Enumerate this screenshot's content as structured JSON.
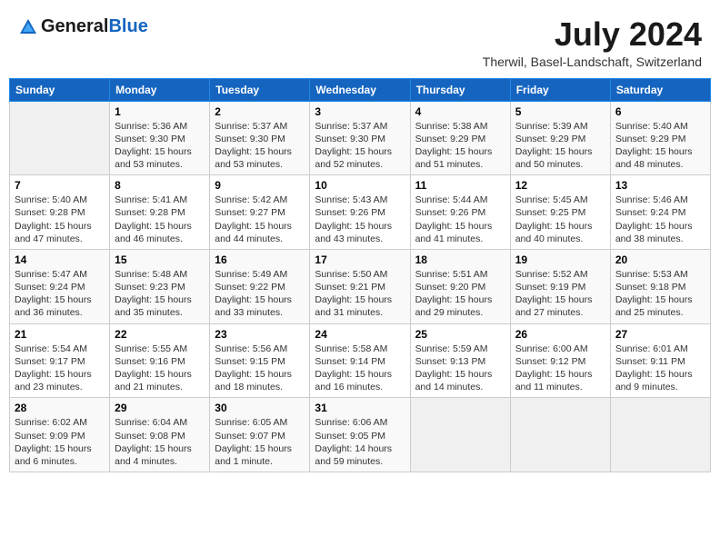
{
  "logo": {
    "general": "General",
    "blue": "Blue"
  },
  "title": "July 2024",
  "location": "Therwil, Basel-Landschaft, Switzerland",
  "days_of_week": [
    "Sunday",
    "Monday",
    "Tuesday",
    "Wednesday",
    "Thursday",
    "Friday",
    "Saturday"
  ],
  "weeks": [
    [
      {
        "day": "",
        "info": ""
      },
      {
        "day": "1",
        "info": "Sunrise: 5:36 AM\nSunset: 9:30 PM\nDaylight: 15 hours\nand 53 minutes."
      },
      {
        "day": "2",
        "info": "Sunrise: 5:37 AM\nSunset: 9:30 PM\nDaylight: 15 hours\nand 53 minutes."
      },
      {
        "day": "3",
        "info": "Sunrise: 5:37 AM\nSunset: 9:30 PM\nDaylight: 15 hours\nand 52 minutes."
      },
      {
        "day": "4",
        "info": "Sunrise: 5:38 AM\nSunset: 9:29 PM\nDaylight: 15 hours\nand 51 minutes."
      },
      {
        "day": "5",
        "info": "Sunrise: 5:39 AM\nSunset: 9:29 PM\nDaylight: 15 hours\nand 50 minutes."
      },
      {
        "day": "6",
        "info": "Sunrise: 5:40 AM\nSunset: 9:29 PM\nDaylight: 15 hours\nand 48 minutes."
      }
    ],
    [
      {
        "day": "7",
        "info": "Sunrise: 5:40 AM\nSunset: 9:28 PM\nDaylight: 15 hours\nand 47 minutes."
      },
      {
        "day": "8",
        "info": "Sunrise: 5:41 AM\nSunset: 9:28 PM\nDaylight: 15 hours\nand 46 minutes."
      },
      {
        "day": "9",
        "info": "Sunrise: 5:42 AM\nSunset: 9:27 PM\nDaylight: 15 hours\nand 44 minutes."
      },
      {
        "day": "10",
        "info": "Sunrise: 5:43 AM\nSunset: 9:26 PM\nDaylight: 15 hours\nand 43 minutes."
      },
      {
        "day": "11",
        "info": "Sunrise: 5:44 AM\nSunset: 9:26 PM\nDaylight: 15 hours\nand 41 minutes."
      },
      {
        "day": "12",
        "info": "Sunrise: 5:45 AM\nSunset: 9:25 PM\nDaylight: 15 hours\nand 40 minutes."
      },
      {
        "day": "13",
        "info": "Sunrise: 5:46 AM\nSunset: 9:24 PM\nDaylight: 15 hours\nand 38 minutes."
      }
    ],
    [
      {
        "day": "14",
        "info": "Sunrise: 5:47 AM\nSunset: 9:24 PM\nDaylight: 15 hours\nand 36 minutes."
      },
      {
        "day": "15",
        "info": "Sunrise: 5:48 AM\nSunset: 9:23 PM\nDaylight: 15 hours\nand 35 minutes."
      },
      {
        "day": "16",
        "info": "Sunrise: 5:49 AM\nSunset: 9:22 PM\nDaylight: 15 hours\nand 33 minutes."
      },
      {
        "day": "17",
        "info": "Sunrise: 5:50 AM\nSunset: 9:21 PM\nDaylight: 15 hours\nand 31 minutes."
      },
      {
        "day": "18",
        "info": "Sunrise: 5:51 AM\nSunset: 9:20 PM\nDaylight: 15 hours\nand 29 minutes."
      },
      {
        "day": "19",
        "info": "Sunrise: 5:52 AM\nSunset: 9:19 PM\nDaylight: 15 hours\nand 27 minutes."
      },
      {
        "day": "20",
        "info": "Sunrise: 5:53 AM\nSunset: 9:18 PM\nDaylight: 15 hours\nand 25 minutes."
      }
    ],
    [
      {
        "day": "21",
        "info": "Sunrise: 5:54 AM\nSunset: 9:17 PM\nDaylight: 15 hours\nand 23 minutes."
      },
      {
        "day": "22",
        "info": "Sunrise: 5:55 AM\nSunset: 9:16 PM\nDaylight: 15 hours\nand 21 minutes."
      },
      {
        "day": "23",
        "info": "Sunrise: 5:56 AM\nSunset: 9:15 PM\nDaylight: 15 hours\nand 18 minutes."
      },
      {
        "day": "24",
        "info": "Sunrise: 5:58 AM\nSunset: 9:14 PM\nDaylight: 15 hours\nand 16 minutes."
      },
      {
        "day": "25",
        "info": "Sunrise: 5:59 AM\nSunset: 9:13 PM\nDaylight: 15 hours\nand 14 minutes."
      },
      {
        "day": "26",
        "info": "Sunrise: 6:00 AM\nSunset: 9:12 PM\nDaylight: 15 hours\nand 11 minutes."
      },
      {
        "day": "27",
        "info": "Sunrise: 6:01 AM\nSunset: 9:11 PM\nDaylight: 15 hours\nand 9 minutes."
      }
    ],
    [
      {
        "day": "28",
        "info": "Sunrise: 6:02 AM\nSunset: 9:09 PM\nDaylight: 15 hours\nand 6 minutes."
      },
      {
        "day": "29",
        "info": "Sunrise: 6:04 AM\nSunset: 9:08 PM\nDaylight: 15 hours\nand 4 minutes."
      },
      {
        "day": "30",
        "info": "Sunrise: 6:05 AM\nSunset: 9:07 PM\nDaylight: 15 hours\nand 1 minute."
      },
      {
        "day": "31",
        "info": "Sunrise: 6:06 AM\nSunset: 9:05 PM\nDaylight: 14 hours\nand 59 minutes."
      },
      {
        "day": "",
        "info": ""
      },
      {
        "day": "",
        "info": ""
      },
      {
        "day": "",
        "info": ""
      }
    ]
  ]
}
